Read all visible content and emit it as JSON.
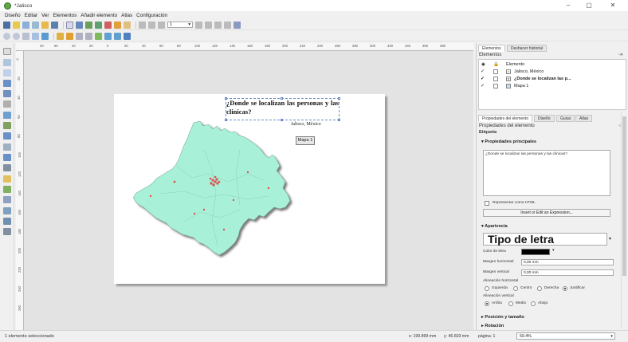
{
  "window": {
    "title": "*Jalisco",
    "min": "–",
    "max": "▢",
    "close": "✕"
  },
  "menu": [
    "Diseño",
    "Editar",
    "Ver",
    "Elementos",
    "Añadir elemento",
    "Atlas",
    "Configuración"
  ],
  "toolbar": {
    "page_value": "1"
  },
  "rulers": {
    "top": [
      "40",
      "60",
      "40",
      "20",
      "0",
      "20",
      "40",
      "60",
      "80",
      "100",
      "120",
      "140",
      "160",
      "180",
      "200",
      "220",
      "240",
      "260",
      "280",
      "300",
      "320",
      "340",
      "360",
      "380"
    ],
    "left": [
      "0",
      "20",
      "40",
      "60",
      "80",
      "100",
      "120",
      "140",
      "160",
      "180",
      "200",
      "220",
      "240",
      "260"
    ]
  },
  "layout": {
    "title": "¿Donde se localizan las personas y las clinicas?",
    "subtitle": "Jalisco, México",
    "map_label": "Mapa 1"
  },
  "colors": {
    "map_fill": "#a8f0d8",
    "map_stroke": "#6a9a8a",
    "points": "#e05050",
    "accent": "#4a7fd0"
  },
  "status": {
    "message": "1 elemento seleccionado",
    "x": "x: 199.899 mm",
    "y": "y: 46.603 mm",
    "page": "página: 1",
    "zoom": "59.4%"
  },
  "panel": {
    "tabs": [
      "Elementos",
      "Deshacer historial"
    ],
    "elements_header": "Elementos",
    "col_label": "Elemento",
    "items": [
      {
        "label": "Jalisco, México",
        "visible": true,
        "icon": "text-icon"
      },
      {
        "label": "¿Donde se localizan las p...",
        "visible": true,
        "icon": "text-icon",
        "selected": true
      },
      {
        "label": "Mapa 1",
        "visible": true,
        "icon": "map-icon"
      }
    ],
    "prop_tabs": [
      "Propiedades del elemento",
      "Diseño",
      "Guías",
      "Atlas"
    ],
    "prop_header": "Propiedades del elemento",
    "prop_type": "Etiqueta",
    "main_props": "Propiedades principales",
    "label_text": "¿Donde se localizan las personas y las clinicas?",
    "render_html": "Representar como HTML",
    "insert_btn": "Insert or Edit an Expression...",
    "appearance": "Apariencia",
    "font_btn": "Tipo de letra",
    "font_color_lbl": "Color de letra",
    "margin_h_lbl": "Margen horizontal",
    "margin_h_val": "0,00 mm",
    "margin_v_lbl": "Margen vertical",
    "margin_v_val": "0,00 mm",
    "halign_lbl": "Alineación horizontal",
    "halign": [
      "Izquierda",
      "Centro",
      "Derecha",
      "Justificar"
    ],
    "valign_lbl": "Alineación vertical",
    "valign": [
      "Arriba",
      "Medio",
      "Abajo"
    ],
    "pos_size": "Posición y tamaño",
    "rotation": "Rotación"
  }
}
